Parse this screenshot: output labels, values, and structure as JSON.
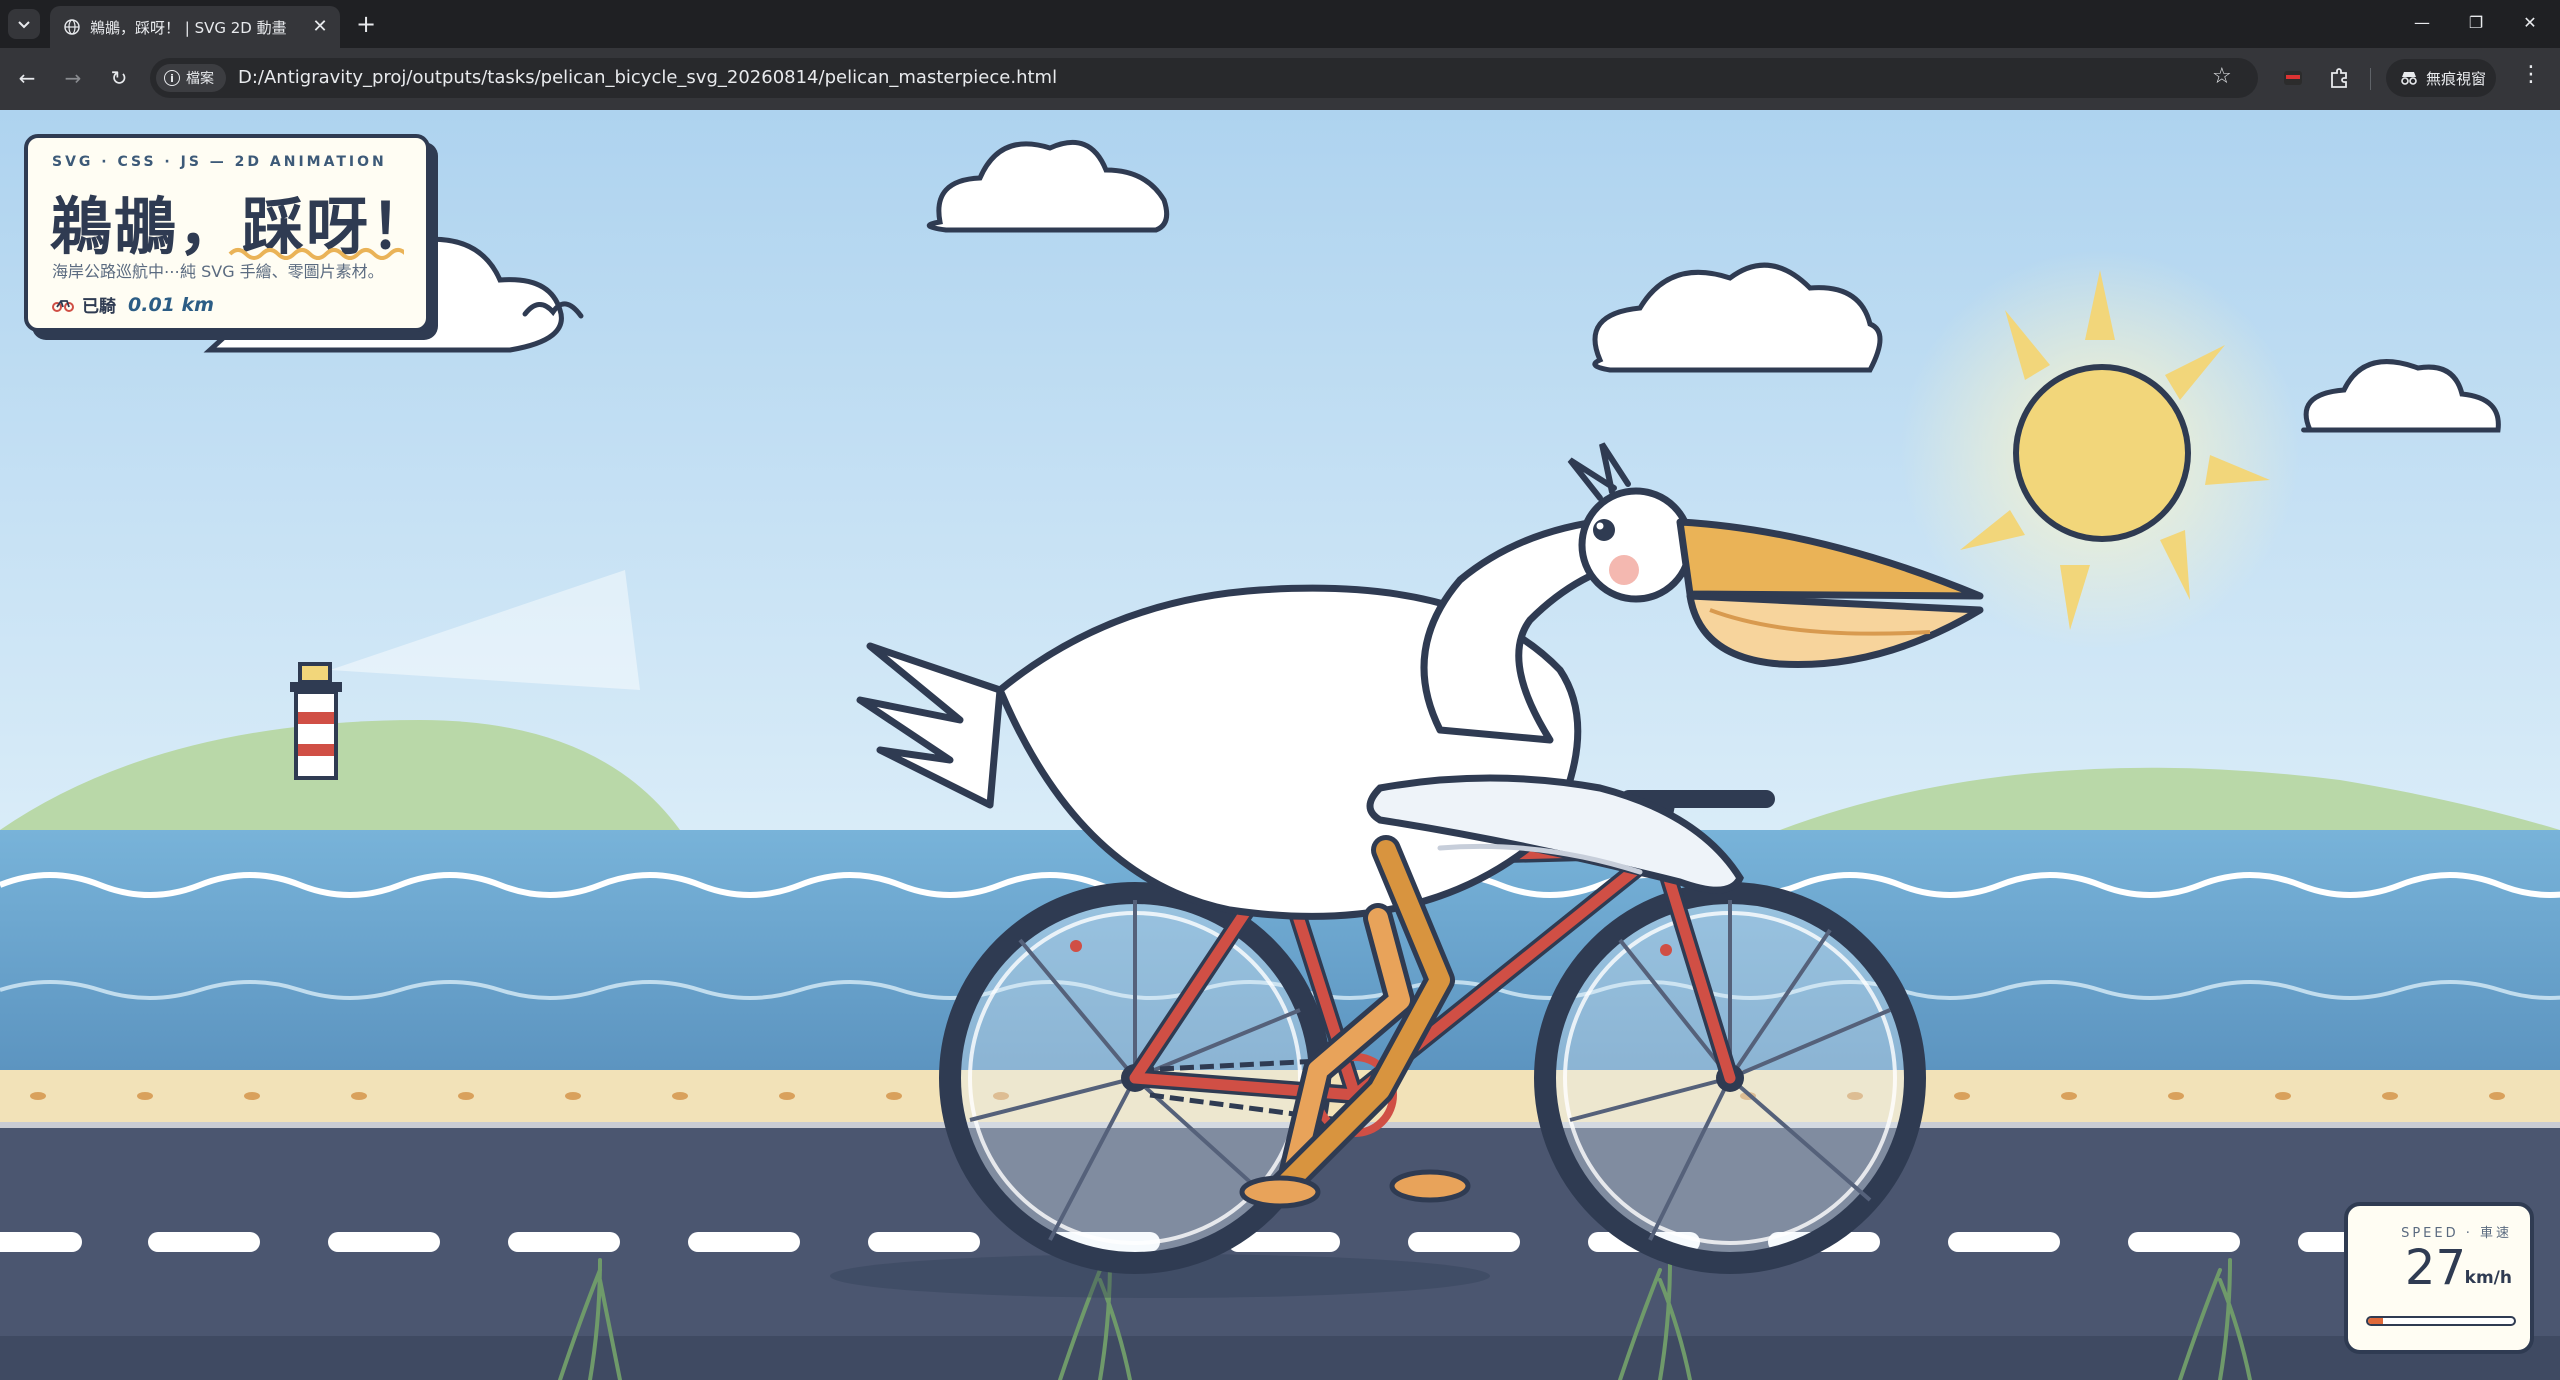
{
  "browser": {
    "tab_title": "鵜鶘，踩呀！ | SVG 2D 動畫",
    "omnibox_chip": "檔案",
    "url": "D:/Antigravity_proj/outputs/tasks/pelican_bicycle_svg_20260814/pelican_masterpiece.html",
    "incognito_label": "無痕視窗",
    "new_tab_symbol": "+",
    "close_symbol": "✕",
    "minimize_symbol": "—",
    "restore_symbol": "❐",
    "window_close_symbol": "✕",
    "back_symbol": "←",
    "forward_symbol": "→",
    "reload_symbol": "↻",
    "star_symbol": "☆",
    "menu_symbol": "⋮"
  },
  "card": {
    "kicker": "SVG · CSS · JS — 2D ANIMATION",
    "title_prefix": "鵜鶘，",
    "title_highlight": "踩呀！",
    "subtitle": "海岸公路巡航中⋯純 SVG 手繪、零圖片素材。",
    "ride_label": "已騎",
    "ride_distance": "0.01 km"
  },
  "speed": {
    "label": "SPEED · 車速",
    "value": "27",
    "unit": "km/h",
    "level_fraction": 0.1
  },
  "colors": {
    "ink": "#2f3b52",
    "sky": "#b6d9f2",
    "sea": "#6fa7d0",
    "sand": "#f2e2b8",
    "road": "#4b5670",
    "bike_frame": "#d04f45",
    "beak": "#eab357",
    "sun": "#f2d67a",
    "accent": "#e06a3a"
  }
}
